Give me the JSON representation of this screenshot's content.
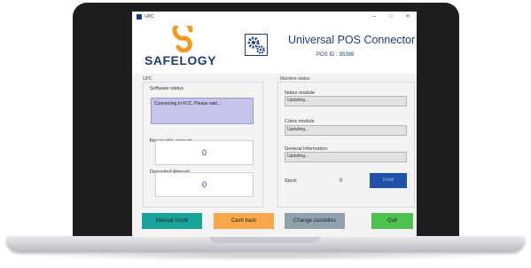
{
  "window": {
    "title": "UPC",
    "minimize": "–",
    "maximize": "□",
    "close": "✕"
  },
  "brand": {
    "name": "SAFELOGY",
    "logo_colors": [
      "#f39a1e",
      "#1f3b82"
    ]
  },
  "header": {
    "title": "Universal POS Connector",
    "pos_id_label": "POS ID :",
    "pos_id_value": "95398"
  },
  "upc_group": {
    "label": "UPC",
    "software_status_label": "Software status",
    "software_status_text": "Connecting to FCC. Please wait...",
    "receivable_label": "Receivable amount",
    "receivable_value": "0",
    "deposited_label": "Deposited Amount",
    "deposited_value": "0"
  },
  "machine_group": {
    "label": "Machine status",
    "notes_label": "Notes module",
    "notes_value": "Updating...",
    "coins_label": "Coins module",
    "coins_value": "Updating...",
    "general_label": "General information",
    "general_value": "Updating...",
    "stock_label": "Stock",
    "stock_value": "0",
    "detail_button": "Detail"
  },
  "buttons": {
    "manual_mode": "Manual mode",
    "cash_back": "Cash back",
    "change_cassettes": "Change cassettes",
    "quit": "Quit"
  },
  "colors": {
    "accent_blue": "#1f3b82",
    "manual_mode": "#1aa39a",
    "cash_back": "#f7a84a",
    "change_cassettes": "#8fa1ad",
    "quit": "#4cc14f",
    "status_box": "#c5c5ec",
    "detail_button": "#1f52a8"
  }
}
